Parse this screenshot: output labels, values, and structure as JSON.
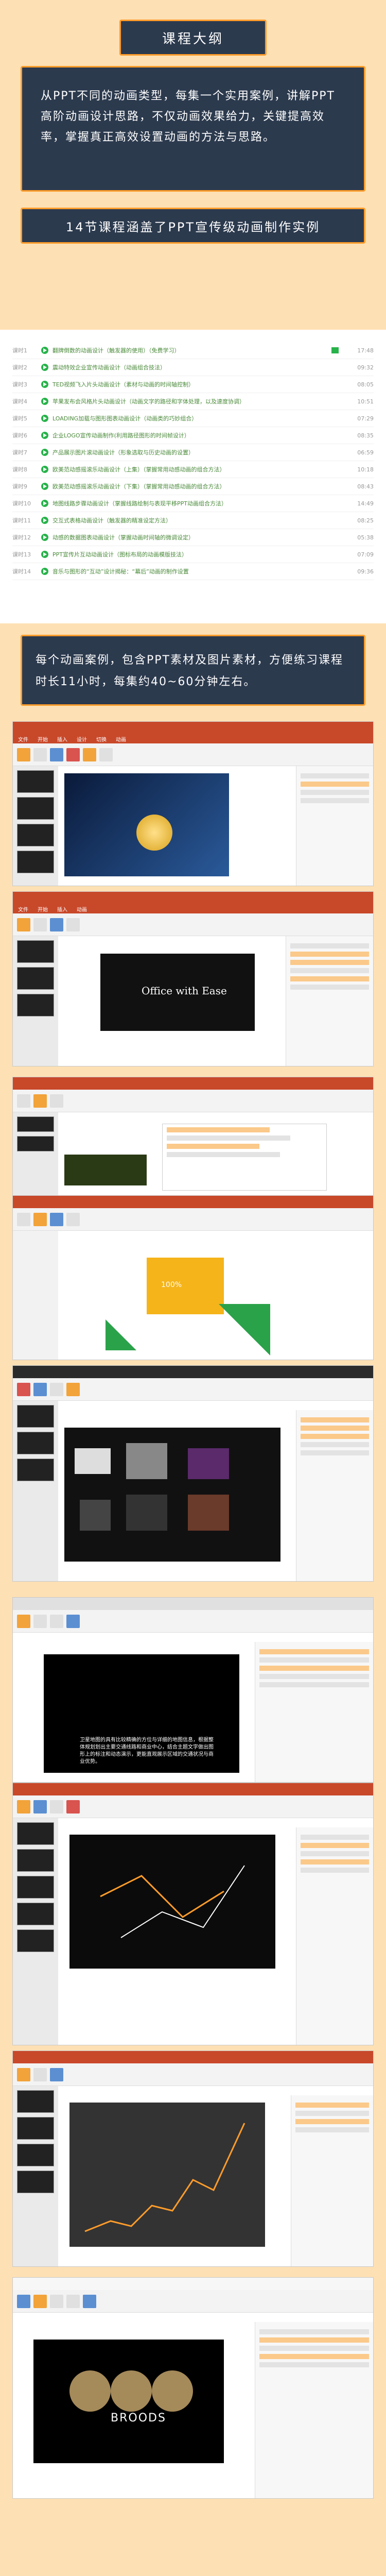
{
  "header": {
    "title": "课程大纲",
    "intro": "从PPT不同的动画类型，每集一个实用案例，讲解PPT高阶动画设计思路，不仅动画效果给力，关键提高效率，掌握真正高效设置动画的方法与思路。",
    "subtitle": "14节课程涵盖了PPT宣传级动画制作实例"
  },
  "courses": [
    {
      "num": "课时1",
      "title": "翻牌倒数的动画设计（触发器的使用）（免费学习）",
      "time": "17:48"
    },
    {
      "num": "课时2",
      "title": "震动特效企业宣传动画设计（动画组合技法）",
      "time": "09:32"
    },
    {
      "num": "课时3",
      "title": "TED视频飞入片头动画设计（素材与动画的时间轴控制）",
      "time": "08:05"
    },
    {
      "num": "课时4",
      "title": "苹果发布会风格片头动画设计（动画文字的路径和字体处理，以及速度协调）",
      "time": "10:51"
    },
    {
      "num": "课时5",
      "title": "LOADING加载与图形图表动画设计（动画类的巧妙组合）",
      "time": "07:29"
    },
    {
      "num": "课时6",
      "title": "企业LOGO宣传动画制作(利用路径图形的时间帧设计）",
      "time": "08:35"
    },
    {
      "num": "课时7",
      "title": "产品展示图片滚动画设计（形象选取与历史动画的设置）",
      "time": "06:59"
    },
    {
      "num": "课时8",
      "title": "欧美范动感摇滚乐动画设计（上集）（掌握常用动感动画的组合方法）",
      "time": "10:18"
    },
    {
      "num": "课时9",
      "title": "欧美范动感摇滚乐动画设计（下集）（掌握常用动感动画的组合方法）",
      "time": "08:43"
    },
    {
      "num": "课时10",
      "title": "地图线路步骤动画设计（掌握线路绘制与表现平移PPT动画组合方法）",
      "time": "14:49"
    },
    {
      "num": "课时11",
      "title": "交互式表格动画设计（触发器的精准设定方法）",
      "time": "08:25"
    },
    {
      "num": "课时12",
      "title": "动感的数据图表动画设计（掌握动画时间轴的微调设定）",
      "time": "05:38"
    },
    {
      "num": "课时13",
      "title": "PPT宣传片互动动画设计（图标布局的动画模版技法）",
      "time": "07:09"
    },
    {
      "num": "课时14",
      "title": "音乐与图形的“互动”设计揭秘：“幕后”动画的制作设置",
      "time": "09:36"
    }
  ],
  "note": "每个动画案例，包含PPT素材及图片素材，方便练习课程时长11小时，每集约40~60分钟左右。",
  "screens": {
    "logo_text": "Office with Ease",
    "percent": "100%",
    "map_caption": "卫星地图的具有比较精确的方位与详细的地图信息，根据整体规划划出主要交通线路和商业中心，结合主题文字做出图形上的标注和动态演示，更能直观展示区域的交通状况与商业优势。",
    "brand": "BROODS"
  },
  "colors": {
    "accent": "#ff9c2a",
    "navy": "#2c3a4e",
    "background": "#fde0b4",
    "ribbon": "#c8482a",
    "green": "#27b24a"
  }
}
